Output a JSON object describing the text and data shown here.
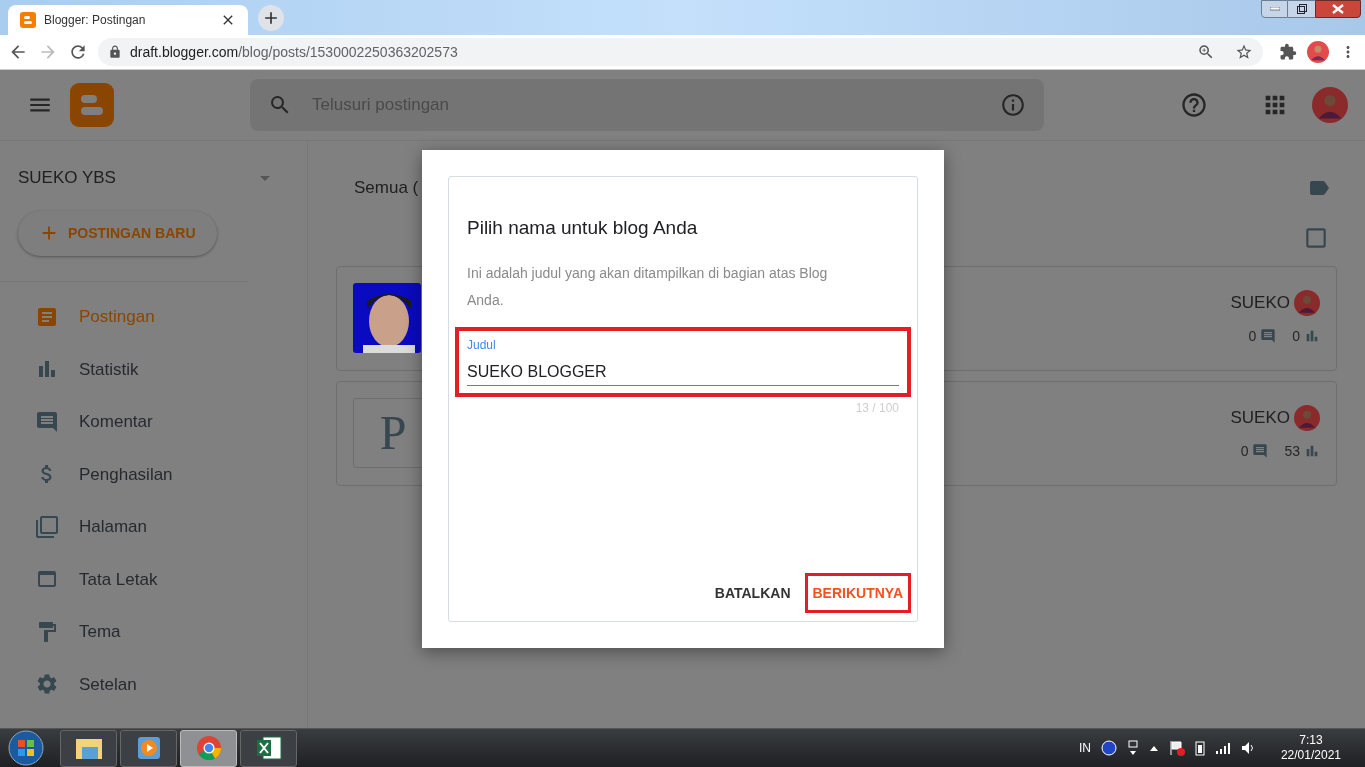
{
  "browser": {
    "tab_title": "Blogger: Postingan",
    "address_host": "draft.blogger.com",
    "address_path": "/blog/posts/1530002250363202573"
  },
  "header": {
    "search_placeholder": "Telusuri postingan"
  },
  "sidebar": {
    "blog_name": "SUEKO YBS",
    "new_post": "POSTINGAN BARU",
    "items": [
      {
        "label": "Postingan",
        "selected": true
      },
      {
        "label": "Statistik",
        "selected": false
      },
      {
        "label": "Komentar",
        "selected": false
      },
      {
        "label": "Penghasilan",
        "selected": false
      },
      {
        "label": "Halaman",
        "selected": false
      },
      {
        "label": "Tata Letak",
        "selected": false
      },
      {
        "label": "Tema",
        "selected": false
      },
      {
        "label": "Setelan",
        "selected": false
      }
    ]
  },
  "content": {
    "filter": "Semua (",
    "posts": [
      {
        "author": "SUEKO",
        "comments": "0",
        "views": "0"
      },
      {
        "thumbnail": {
          "kind": "letter",
          "letter": "P"
        },
        "author": "SUEKO",
        "comments": "0",
        "views": "53"
      }
    ]
  },
  "dialog": {
    "title": "Pilih nama untuk blog Anda",
    "description": "Ini adalah judul yang akan ditampilkan di bagian atas Blog Anda.",
    "field_label": "Judul",
    "value": "SUEKO BLOGGER",
    "counter": "13 / 100",
    "buttons": [
      {
        "label": "BATALKAN",
        "kind": "cancel"
      },
      {
        "label": "BERIKUTNYA",
        "kind": "primary"
      }
    ]
  },
  "taskbar": {
    "language": "IN",
    "time": "7:13",
    "date": "22/01/2021",
    "apps": [
      {
        "selected": false
      },
      {
        "selected": false
      },
      {
        "selected": true
      },
      {
        "selected": false
      }
    ]
  }
}
